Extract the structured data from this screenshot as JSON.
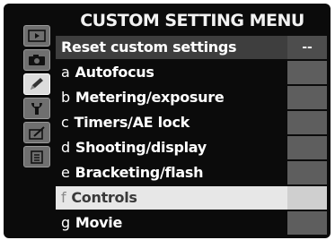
{
  "title": "CUSTOM SETTING MENU",
  "sidebar": {
    "tabs": [
      {
        "icon": "playback-icon",
        "active": false
      },
      {
        "icon": "camera-icon",
        "active": false
      },
      {
        "icon": "pencil-icon",
        "active": true
      },
      {
        "icon": "wrench-icon",
        "active": false
      },
      {
        "icon": "retouch-icon",
        "active": false
      },
      {
        "icon": "my-menu-icon",
        "active": false
      }
    ]
  },
  "menu": {
    "reset": {
      "label": "Reset custom settings",
      "value": "--"
    },
    "items": [
      {
        "letter": "a",
        "label": "Autofocus"
      },
      {
        "letter": "b",
        "label": "Metering/exposure"
      },
      {
        "letter": "c",
        "label": "Timers/AE lock"
      },
      {
        "letter": "d",
        "label": "Shooting/display"
      },
      {
        "letter": "e",
        "label": "Bracketing/flash"
      },
      {
        "letter": "f",
        "label": "Controls",
        "selected": true
      },
      {
        "letter": "g",
        "label": "Movie"
      }
    ]
  }
}
